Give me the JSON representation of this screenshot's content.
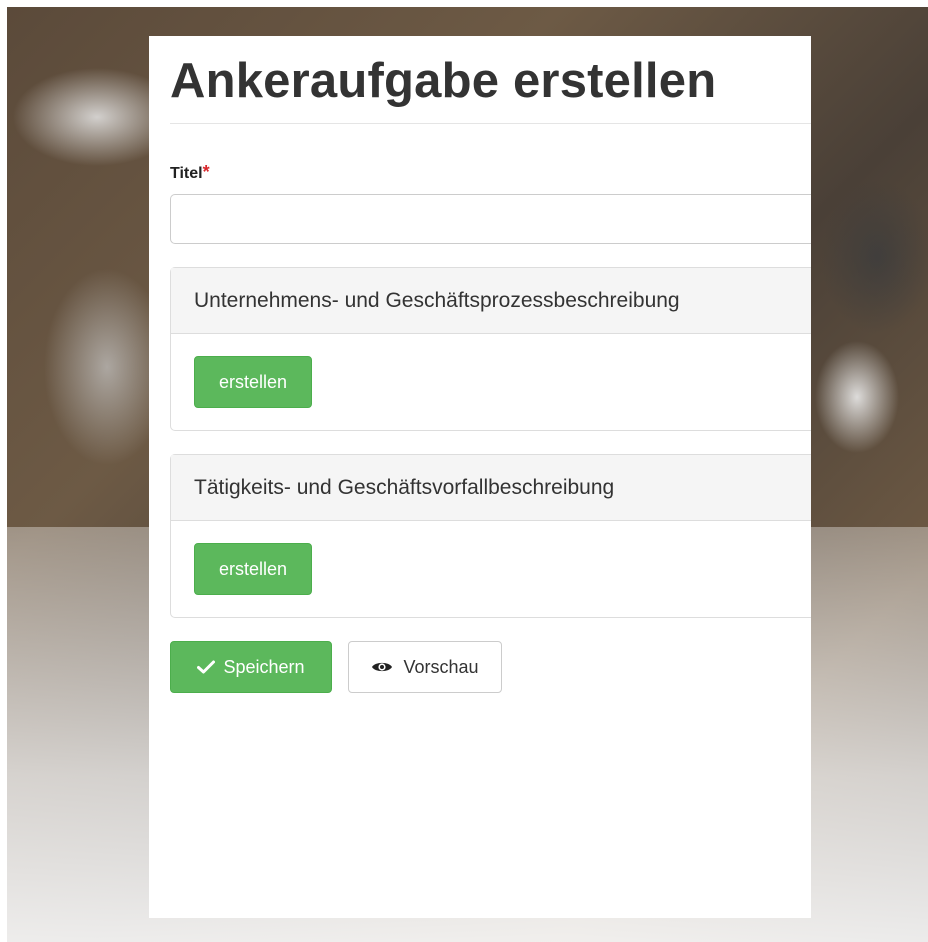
{
  "page": {
    "title": "Ankeraufgabe erstellen"
  },
  "form": {
    "title_label": "Titel",
    "required_marker": "*",
    "title_value": "",
    "sections": [
      {
        "heading": "Unternehmens- und Geschäftsprozessbeschreibung",
        "button_label": "erstellen"
      },
      {
        "heading": "Tätigkeits- und Geschäftsvorfallbeschreibung",
        "button_label": "erstellen"
      }
    ],
    "save_label": "Speichern",
    "preview_label": "Vorschau"
  },
  "icons": {
    "save": "checkmark-icon",
    "preview": "eye-icon"
  },
  "colors": {
    "success": "#5cb85c",
    "required": "#d9262b"
  }
}
